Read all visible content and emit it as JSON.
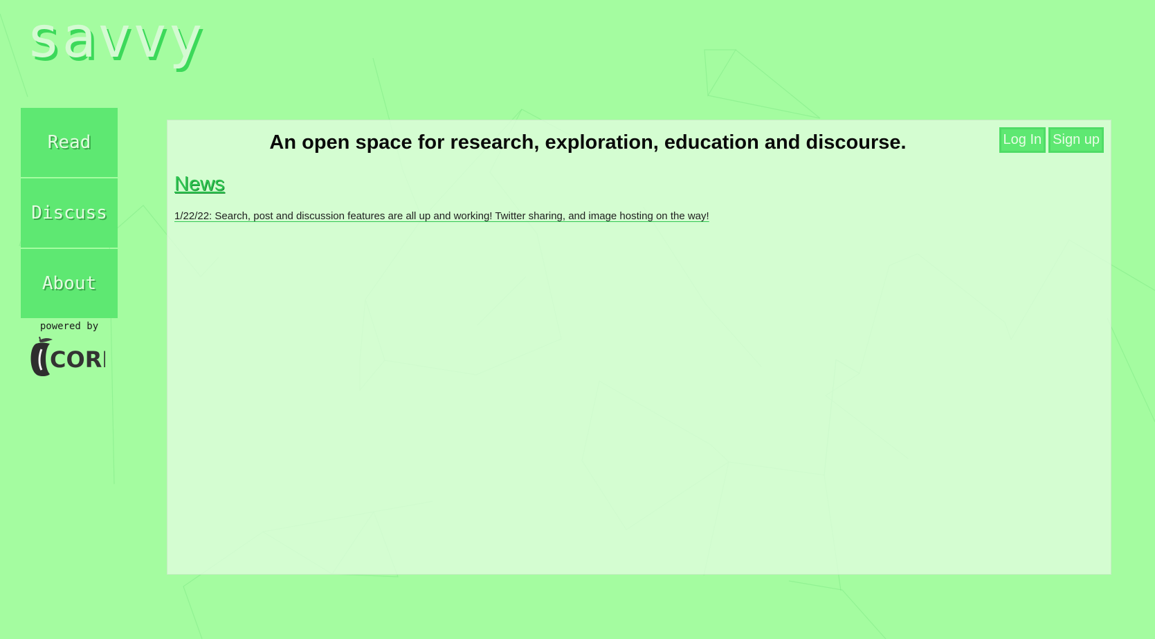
{
  "brand": {
    "logo_text": "savvy"
  },
  "nav": {
    "items": [
      {
        "label": "Read"
      },
      {
        "label": "Discuss"
      },
      {
        "label": "About"
      }
    ]
  },
  "powered_by": {
    "label": "powered by",
    "logo_text": "CORE",
    "logo_icon": "apple-core-icon"
  },
  "header": {
    "tagline": "An open space for research, exploration, education and discourse."
  },
  "auth": {
    "login_label": "Log In",
    "signup_label": "Sign up"
  },
  "news": {
    "title": "News",
    "items": [
      {
        "text": "1/22/22: Search, post and discussion features are all up and working! Twitter sharing, and image hosting on the way!"
      }
    ]
  },
  "colors": {
    "background": "#a4fca0",
    "accent": "#5ee872",
    "panel": "#dcfcda",
    "link": "#2fc451"
  }
}
